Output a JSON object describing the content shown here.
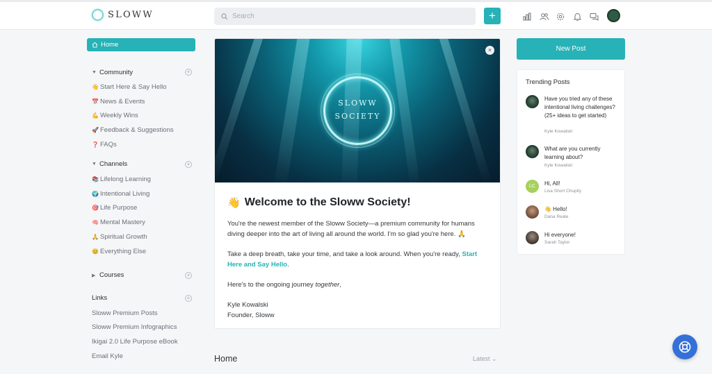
{
  "brand": {
    "name": "SLOWW"
  },
  "search": {
    "placeholder": "Search"
  },
  "topbar": {
    "plus_label": "+",
    "icons": [
      "chart-icon",
      "people-icon",
      "settings-icon",
      "bell-icon",
      "chat-icon"
    ]
  },
  "sidebar": {
    "home": "Home",
    "community": {
      "title": "Community",
      "items": [
        {
          "emoji": "👋",
          "label": "Start Here & Say Hello"
        },
        {
          "emoji": "📅",
          "label": "News & Events"
        },
        {
          "emoji": "💪",
          "label": "Weekly Wins"
        },
        {
          "emoji": "🚀",
          "label": "Feedback & Suggestions"
        },
        {
          "emoji": "❓",
          "label": "FAQs"
        }
      ]
    },
    "channels": {
      "title": "Channels",
      "items": [
        {
          "emoji": "📚",
          "label": "Lifelong Learning"
        },
        {
          "emoji": "🌍",
          "label": "Intentional Living"
        },
        {
          "emoji": "🎯",
          "label": "Life Purpose"
        },
        {
          "emoji": "🧠",
          "label": "Mental Mastery"
        },
        {
          "emoji": "🙏",
          "label": "Spiritual Growth"
        },
        {
          "emoji": "😊",
          "label": "Everything Else"
        }
      ]
    },
    "courses": {
      "title": "Courses"
    },
    "links": {
      "title": "Links",
      "items": [
        "Sloww Premium Posts",
        "Sloww Premium Infographics",
        "Ikigai 2.0 Life Purpose eBook",
        "Email Kyle"
      ]
    }
  },
  "welcome": {
    "hero_line1": "SLOWW",
    "hero_line2": "SOCIETY",
    "close": "×",
    "wave": "👋",
    "title": "Welcome to the Sloww Society!",
    "p1": "You're the newest member of the Sloww Society—a premium community for humans diving deeper into the art of living all around the world. I'm so glad you're here. 🙏",
    "p2_text": "Take a deep breath, take your time, and take a look around. When you're ready, ",
    "p2_link": "Start Here and Say Hello",
    "p2_end": ".",
    "p3_text": "Here's to the ongoing journey ",
    "p3_em": "together",
    "p3_end": ",",
    "sign_name": "Kyle Kowalski",
    "sign_title": "Founder, Sloww"
  },
  "feed": {
    "title": "Home",
    "sort": "Latest"
  },
  "right": {
    "new_post": "New Post",
    "trending_title": "Trending Posts",
    "posts": [
      {
        "title": "Have you tried any of these intentional living challenges? (25+ ideas to get started)",
        "author": "Kyle Kowalski",
        "avatar": "kyle"
      },
      {
        "title": "What are you currently learning about?",
        "author": "Kyle Kowalski",
        "avatar": "kyle"
      },
      {
        "title": "Hi, All!",
        "author": "Lisa Short Chupity",
        "avatar": "lc",
        "initials": "LC"
      },
      {
        "title": "👋 Hello!",
        "author": "Dana Reale",
        "avatar": "dana"
      },
      {
        "title": "Hi everyone!",
        "author": "Sarah Taylor",
        "avatar": "sarah"
      }
    ]
  },
  "colors": {
    "accent": "#26b2b6",
    "help": "#3570d9"
  }
}
